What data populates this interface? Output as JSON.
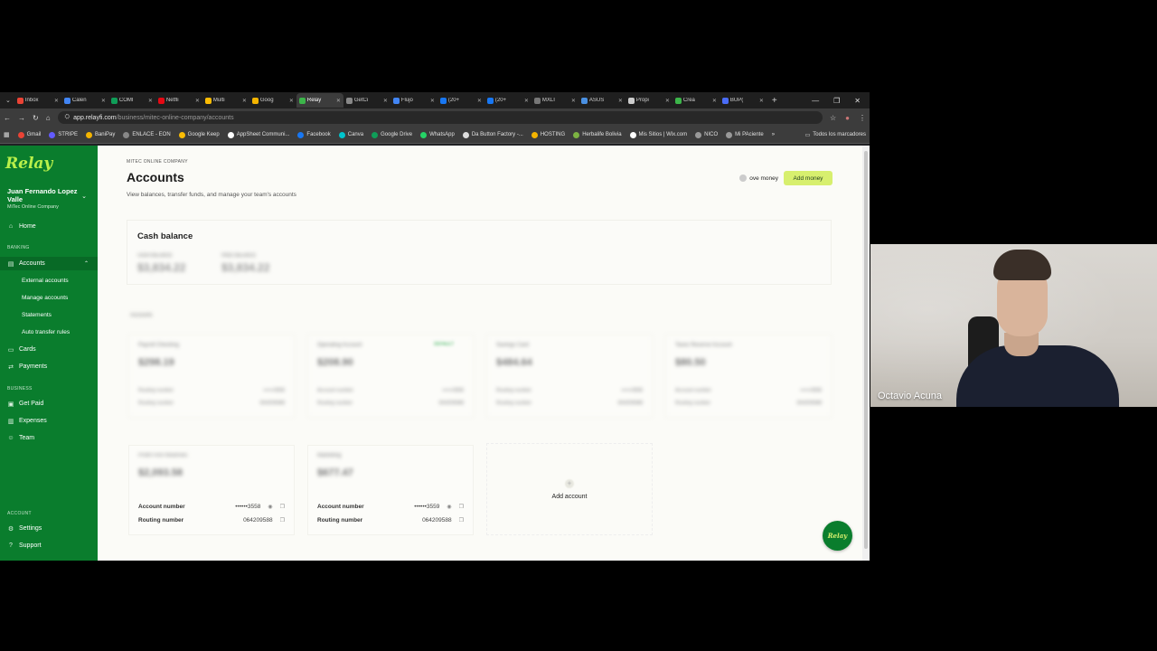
{
  "browser": {
    "tabs": [
      {
        "label": "Inbox",
        "color": "#ea4335"
      },
      {
        "label": "Calen",
        "color": "#4285f4"
      },
      {
        "label": "COMI",
        "color": "#0f9d58"
      },
      {
        "label": "Netfli",
        "color": "#e50914"
      },
      {
        "label": "Multi",
        "color": "#fbbc04"
      },
      {
        "label": "Goog",
        "color": "#f4b400"
      },
      {
        "label": "Relay",
        "color": "#3cb54a"
      },
      {
        "label": "GetCi",
        "color": "#888888"
      },
      {
        "label": "Flujo",
        "color": "#4285f4"
      },
      {
        "label": "(20+",
        "color": "#1877f2"
      },
      {
        "label": "(20+",
        "color": "#1877f2"
      },
      {
        "label": "MXLI",
        "color": "#777777"
      },
      {
        "label": "ASUS",
        "color": "#4a90e2"
      },
      {
        "label": "Propi",
        "color": "#cccccc"
      },
      {
        "label": "Crea",
        "color": "#3cb54a"
      },
      {
        "label": "BUP(",
        "color": "#4a6cf7"
      }
    ],
    "active_tab_index": 6,
    "new_tab": "+",
    "url_host": "app.relayfi.com",
    "url_path": "/business/mitec-online-company/accounts",
    "bookmarks": [
      {
        "label": "Gmail",
        "color": "#ea4335"
      },
      {
        "label": "STRIPE",
        "color": "#635bff"
      },
      {
        "label": "BaniPay",
        "color": "#f4b400"
      },
      {
        "label": "ENLACE - EON",
        "color": "#888888"
      },
      {
        "label": "Google Keep",
        "color": "#fbbc04"
      },
      {
        "label": "AppSheet Communi...",
        "color": "#ffffff"
      },
      {
        "label": "Facebook",
        "color": "#1877f2"
      },
      {
        "label": "Canva",
        "color": "#00c4cc"
      },
      {
        "label": "Google Drive",
        "color": "#0f9d58"
      },
      {
        "label": "WhatsApp",
        "color": "#25d366"
      },
      {
        "label": "Da Button Factory -...",
        "color": "#dddddd"
      },
      {
        "label": "HOSTING",
        "color": "#f4b400"
      },
      {
        "label": "Herbalife Bolivia",
        "color": "#7cb342"
      },
      {
        "label": "Mis Sitios | Wix.com",
        "color": "#ffffff"
      },
      {
        "label": "NICO",
        "color": "#999999"
      },
      {
        "label": "Mi PAciente",
        "color": "#999999"
      }
    ],
    "bookmarks_more": "»",
    "all_bookmarks": "Todos los marcadores"
  },
  "sidebar": {
    "logo": "Relay",
    "user_name": "Juan Fernando Lopez Valle",
    "company": "MiTec Online Company",
    "home": "Home",
    "banking_label": "BANKING",
    "accounts": "Accounts",
    "sub_items": [
      "External accounts",
      "Manage accounts",
      "Statements",
      "Auto transfer rules"
    ],
    "cards": "Cards",
    "payments": "Payments",
    "business_label": "BUSINESS",
    "get_paid": "Get Paid",
    "expenses": "Expenses",
    "team": "Team",
    "account_label": "ACCOUNT",
    "settings": "Settings",
    "support": "Support"
  },
  "main": {
    "breadcrumb": "MITEC ONLINE COMPANY",
    "title": "Accounts",
    "subtitle": "View balances, transfer funds, and manage your team's accounts",
    "move_money": "ove money",
    "add_money": "Add money",
    "cash_balance_title": "Cash balance",
    "cash_label_1": "CASH BALANCE",
    "cash_value_1": "$3,834.22",
    "cash_label_2": "FREE BALANCE",
    "cash_value_2": "$3,834.22",
    "accounts_header": "Accounts",
    "cards": [
      {
        "name": "Payroll Checking",
        "balance": "$298.19",
        "tag": "",
        "r1l": "Routing number",
        "r1v": "••••••3558",
        "r2l": "Routing number",
        "r2v": "064209588"
      },
      {
        "name": "Operating Account",
        "balance": "$208.90",
        "tag": "DEFAULT",
        "r1l": "Account number",
        "r1v": "••••••3558",
        "r2l": "Routing number",
        "r2v": "064209588"
      },
      {
        "name": "Savings Card",
        "balance": "$484.64",
        "tag": "",
        "r1l": "Routing number",
        "r1v": "••••••3558",
        "r2l": "Routing number",
        "r2v": "064209588"
      },
      {
        "name": "Taxes Reserve Account",
        "balance": "$80.50",
        "tag": "",
        "r1l": "Account number",
        "r1v": "••••••3558",
        "r2l": "Routing number",
        "r2v": "064209588"
      },
      {
        "name": "Profit First Reserves",
        "balance": "$2,093.58",
        "tag": "",
        "r1l": "Account number",
        "r1v": "••••••3558",
        "r2l": "Routing number",
        "r2v": "064209588"
      },
      {
        "name": "Marketing",
        "balance": "$677.47",
        "tag": "",
        "r1l": "Account number",
        "r1v": "••••••3559",
        "r2l": "Routing number",
        "r2v": "064209588"
      }
    ],
    "add_account": "Add account",
    "fab_label": "Relay"
  },
  "video": {
    "participant": "Octavio Acuna"
  }
}
